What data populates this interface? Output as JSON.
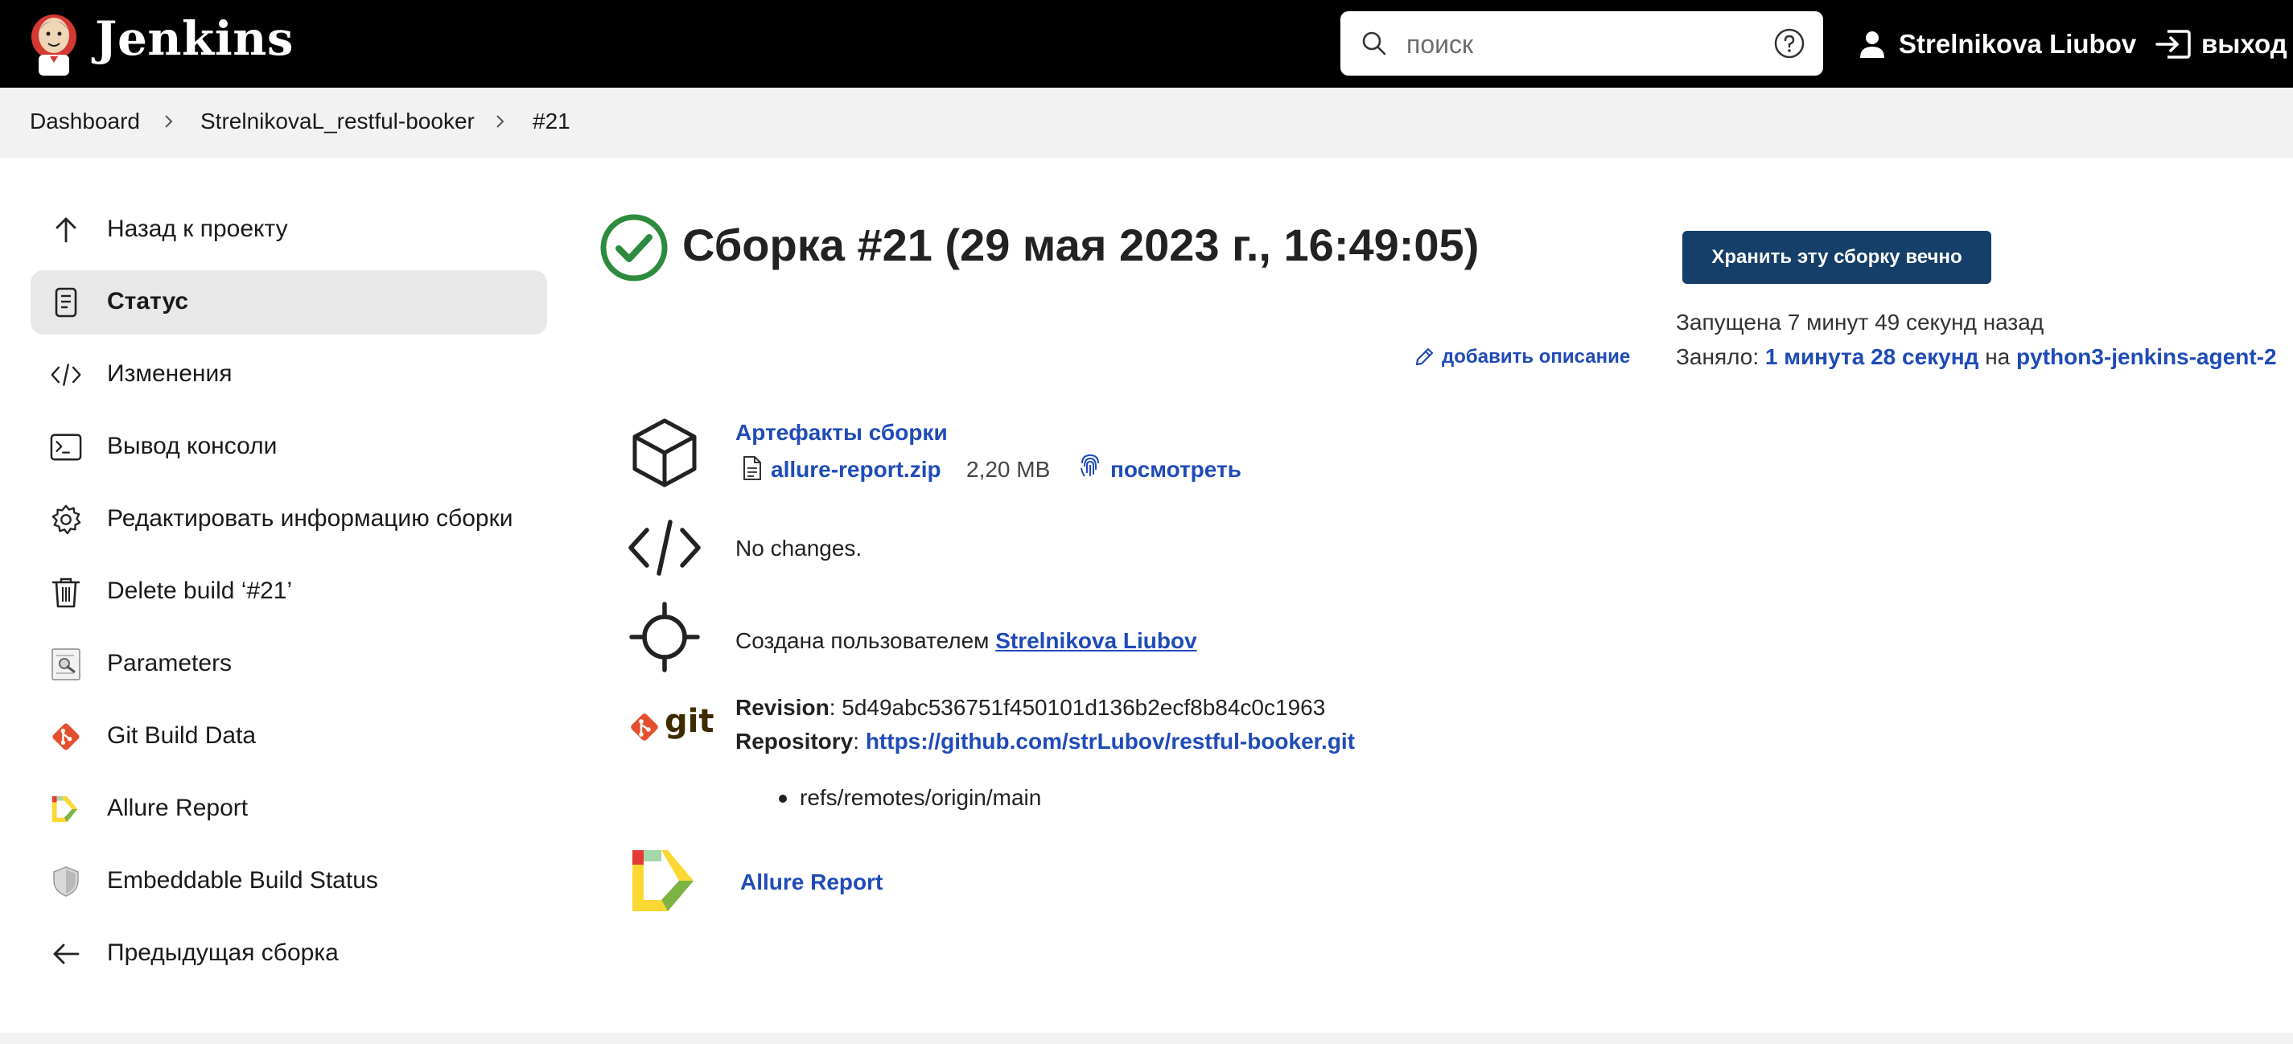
{
  "header": {
    "brand": "Jenkins",
    "search_placeholder": "поиск",
    "user_name": "Strelnikova Liubov",
    "logout_label": "выход"
  },
  "breadcrumb": [
    "Dashboard",
    "StrelnikovaL_restful-booker",
    "#21"
  ],
  "sidebar": {
    "items": [
      {
        "label": "Назад к проекту",
        "icon": "arrow-up-icon"
      },
      {
        "label": "Статус",
        "icon": "document-icon"
      },
      {
        "label": "Изменения",
        "icon": "code-icon"
      },
      {
        "label": "Вывод консоли",
        "icon": "terminal-icon"
      },
      {
        "label": "Редактировать информацию сборки",
        "icon": "gear-icon"
      },
      {
        "label": "Delete build ‘#21’",
        "icon": "trash-icon"
      },
      {
        "label": "Parameters",
        "icon": "parameters-icon"
      },
      {
        "label": "Git Build Data",
        "icon": "git-icon"
      },
      {
        "label": "Allure Report",
        "icon": "allure-icon"
      },
      {
        "label": "Embeddable Build Status",
        "icon": "shield-icon"
      },
      {
        "label": "Предыдущая сборка",
        "icon": "arrow-left-icon"
      }
    ]
  },
  "build": {
    "title": "Сборка #21 (29 мая 2023 г., 16:49:05)",
    "keep_forever_label": "Хранить эту сборку вечно",
    "started": "Запущена 7 минут 49 секунд назад",
    "took_prefix": "Заняло:",
    "duration": "1 минута 28 секунд",
    "on_label": "на",
    "agent": "python3-jenkins-agent-2",
    "add_description": "добавить описание"
  },
  "artifacts": {
    "title": "Артефакты сборки",
    "file_name": "allure-report.zip",
    "file_size": "2,20 MB",
    "view_label": "посмотреть"
  },
  "changes": {
    "text": "No changes."
  },
  "cause": {
    "prefix": "Создана пользователем",
    "user": "Strelnikova Liubov"
  },
  "git": {
    "git_label": "git",
    "revision_label": "Revision",
    "revision": "5d49abc536751f450101d136b2ecf8b84c0c1963",
    "repository_label": "Repository",
    "repository": "https://github.com/strLubov/restful-booker.git",
    "branches": [
      "refs/remotes/origin/main"
    ]
  },
  "allure": {
    "label": "Allure Report"
  },
  "colors": {
    "header_bg": "#000000",
    "link": "#1f4bb8",
    "button_bg": "#153e68",
    "success": "#2e8b3e"
  }
}
